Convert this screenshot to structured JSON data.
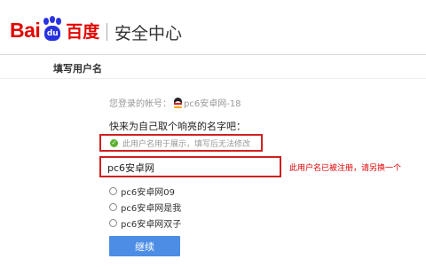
{
  "header": {
    "logo_bai": "Bai",
    "logo_du": "du",
    "logo_cn": "百度",
    "center_title": "安全中心"
  },
  "section": {
    "title": "填写用户名"
  },
  "account": {
    "label": "您登录的帐号：",
    "name": "pc6安卓网-18",
    "icon": "qq-penguin-icon"
  },
  "prompt": "快来为自己取个响亮的名字吧：",
  "notice": {
    "icon": "check-circle-icon",
    "text": "此用户名用于展示，填写后无法修改"
  },
  "username_input": {
    "value": "pc6安卓网",
    "error": "此用户名已被注册，请另换一个"
  },
  "suggestions": [
    {
      "label": "pc6安卓网09"
    },
    {
      "label": "pc6安卓网是我"
    },
    {
      "label": "pc6安卓网双子"
    }
  ],
  "continue_label": "继续",
  "colors": {
    "brand_red": "#e10602",
    "brand_blue": "#2932e1",
    "error_red": "#d02020",
    "button_blue": "#4d8de6"
  }
}
